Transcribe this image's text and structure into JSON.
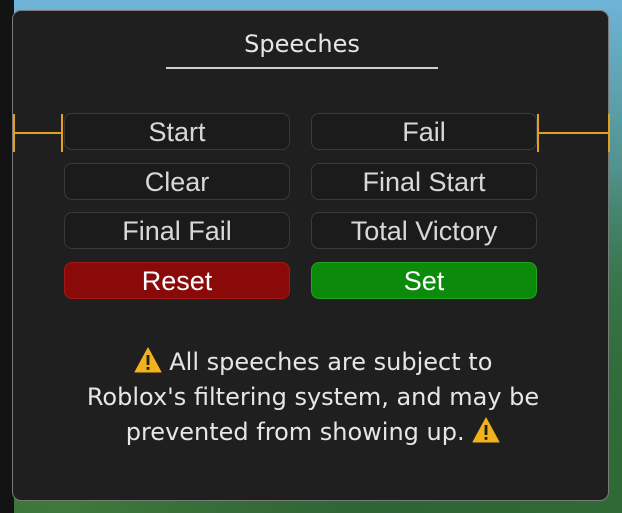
{
  "panel": {
    "title": "Speeches"
  },
  "buttons": {
    "start": "Start",
    "fail": "Fail",
    "clear": "Clear",
    "final_start": "Final Start",
    "final_fail": "Final Fail",
    "total_victory": "Total Victory",
    "reset": "Reset",
    "set": "Set"
  },
  "notice": {
    "line1": "All speeches are subject to",
    "line2": "Roblox's filtering system, and may be",
    "line3": "prevented from showing up.",
    "icon": "warning-icon"
  },
  "colors": {
    "panel_bg": "#1f1f1f",
    "reset": "#8a0a0a",
    "set": "#0b8a0b",
    "handle": "#e0a020",
    "warning": "#f2b21c"
  }
}
